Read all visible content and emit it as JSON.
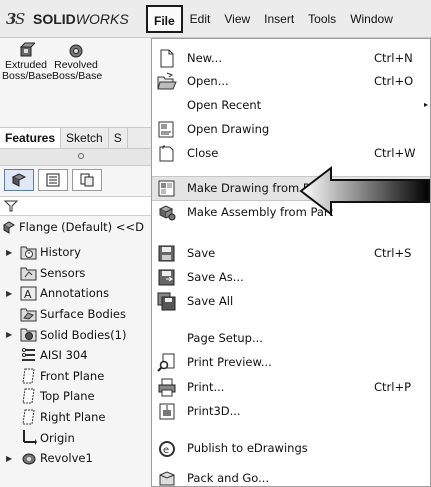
{
  "app": {
    "logo_prefix": "SOLID",
    "logo_suffix": "WORKS"
  },
  "menubar": [
    "File",
    "Edit",
    "View",
    "Insert",
    "Tools",
    "Window"
  ],
  "commands": [
    {
      "label_line1": "Extruded",
      "label_line2": "Boss/Base",
      "icon": "extruded-boss-icon"
    },
    {
      "label_line1": "Revolved",
      "label_line2": "Boss/Base",
      "icon": "revolved-boss-icon"
    }
  ],
  "tabs": [
    "Features",
    "Sketch",
    "S"
  ],
  "tree": {
    "root_label": "Flange (Default) <<D",
    "items": [
      {
        "label": "History",
        "icon": "history-icon",
        "expandable": true
      },
      {
        "label": "Sensors",
        "icon": "sensors-icon",
        "expandable": false
      },
      {
        "label": "Annotations",
        "icon": "annotations-icon",
        "expandable": true
      },
      {
        "label": "Surface Bodies",
        "icon": "surface-bodies-icon",
        "expandable": false
      },
      {
        "label": "Solid Bodies(1)",
        "icon": "solid-bodies-icon",
        "expandable": true
      },
      {
        "label": "AISI 304",
        "icon": "material-icon",
        "expandable": false
      },
      {
        "label": "Front Plane",
        "icon": "plane-icon",
        "expandable": false
      },
      {
        "label": "Top Plane",
        "icon": "plane-icon",
        "expandable": false
      },
      {
        "label": "Right Plane",
        "icon": "plane-icon",
        "expandable": false
      },
      {
        "label": "Origin",
        "icon": "origin-icon",
        "expandable": false
      },
      {
        "label": "Revolve1",
        "icon": "revolve-feature-icon",
        "expandable": true
      }
    ]
  },
  "file_menu": [
    {
      "label": "New...",
      "shortcut": "Ctrl+N",
      "icon": "new-document-icon"
    },
    {
      "label": "Open...",
      "shortcut": "Ctrl+O",
      "icon": "open-folder-icon"
    },
    {
      "label": "Open Recent",
      "shortcut": "",
      "icon": "",
      "submenu": true
    },
    {
      "label": "Open Drawing",
      "shortcut": "",
      "icon": "open-drawing-icon"
    },
    {
      "label": "Close",
      "shortcut": "Ctrl+W",
      "icon": "close-document-icon"
    },
    {
      "label": "Make Drawing from Part",
      "shortcut": "",
      "icon": "make-drawing-icon",
      "highlighted": true
    },
    {
      "label": "Make Assembly from Part",
      "shortcut": "",
      "icon": "make-assembly-icon"
    },
    {
      "label": "Save",
      "shortcut": "Ctrl+S",
      "icon": "save-icon"
    },
    {
      "label": "Save As...",
      "shortcut": "",
      "icon": "save-as-icon"
    },
    {
      "label": "Save All",
      "shortcut": "",
      "icon": "save-all-icon"
    },
    {
      "label": "Page Setup...",
      "shortcut": "",
      "icon": ""
    },
    {
      "label": "Print Preview...",
      "shortcut": "",
      "icon": "print-preview-icon"
    },
    {
      "label": "Print...",
      "shortcut": "Ctrl+P",
      "icon": "print-icon"
    },
    {
      "label": "Print3D...",
      "shortcut": "",
      "icon": "print3d-icon"
    },
    {
      "label": "Publish to eDrawings",
      "shortcut": "",
      "icon": "edrawings-icon"
    },
    {
      "label": "Pack and Go...",
      "shortcut": "",
      "icon": "pack-and-go-icon"
    }
  ],
  "submenu_arrow": "▸",
  "expand_arrow": "▶",
  "colors": {
    "menu_border": "#1a1a1a",
    "highlight": "#e4e4e4",
    "accent_blue": "#5d7da6"
  }
}
